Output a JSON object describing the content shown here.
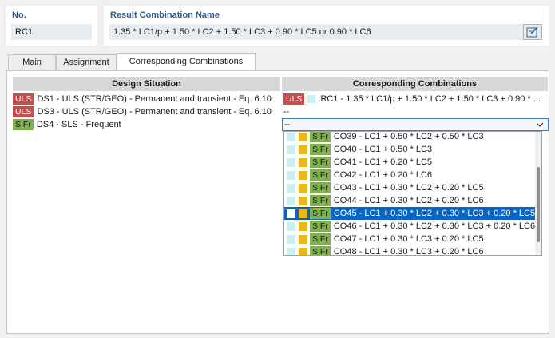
{
  "no": {
    "label": "No.",
    "value": "RC1"
  },
  "name": {
    "label": "Result Combination Name",
    "value": "1.35 * LC1/p + 1.50 * LC2 + 1.50 * LC3 + 0.90 * LC5 or 0.90 * LC6"
  },
  "tabs": [
    {
      "label": "Main"
    },
    {
      "label": "Assignment"
    },
    {
      "label": "Corresponding Combinations"
    }
  ],
  "grid": {
    "col_left": "Design Situation",
    "col_right": "Corresponding Combinations",
    "rows": [
      {
        "badge": "ULS",
        "text": "DS1 - ULS (STR/GEO) - Permanent and transient - Eq. 6.10",
        "right_badge": "ULS",
        "right_text": "RC1 - 1.35 * LC1/p + 1.50 * LC2 + 1.50 * LC3 + 0.90 * ..."
      },
      {
        "badge": "ULS",
        "text": "DS3 - ULS (STR/GEO) - Permanent and transient - Eq. 6.10",
        "right_text": "--"
      },
      {
        "badge": "S Fr",
        "text": "DS4 - SLS - Frequent",
        "right_text": "--"
      }
    ]
  },
  "dropdown": {
    "items": [
      {
        "badge": "S Fr",
        "text": "CO39 - LC1 + 0.50 * LC2 + 0.50 * LC3",
        "selected": false
      },
      {
        "badge": "S Fr",
        "text": "CO40 - LC1 + 0.50 * LC3",
        "selected": false
      },
      {
        "badge": "S Fr",
        "text": "CO41 - LC1 + 0.20 * LC5",
        "selected": false
      },
      {
        "badge": "S Fr",
        "text": "CO42 - LC1 + 0.20 * LC6",
        "selected": false
      },
      {
        "badge": "S Fr",
        "text": "CO43 - LC1 + 0.30 * LC2 + 0.20 * LC5",
        "selected": false
      },
      {
        "badge": "S Fr",
        "text": "CO44 - LC1 + 0.30 * LC2 + 0.20 * LC6",
        "selected": false
      },
      {
        "badge": "S Fr",
        "text": "CO45 - LC1 + 0.30 * LC2 + 0.30 * LC3 + 0.20 * LC5",
        "selected": true
      },
      {
        "badge": "S Fr",
        "text": "CO46 - LC1 + 0.30 * LC2 + 0.30 * LC3 + 0.20 * LC6",
        "selected": false
      },
      {
        "badge": "S Fr",
        "text": "CO47 - LC1 + 0.30 * LC3 + 0.20 * LC5",
        "selected": false
      },
      {
        "badge": "S Fr",
        "text": "CO48 - LC1 + 0.30 * LC3 + 0.20 * LC6",
        "selected": false
      }
    ]
  },
  "colors": {
    "uls": "#c84c4c",
    "sfr": "#7fb24a",
    "selection": "#0a64c2",
    "accent_label": "#2f5f8f"
  }
}
